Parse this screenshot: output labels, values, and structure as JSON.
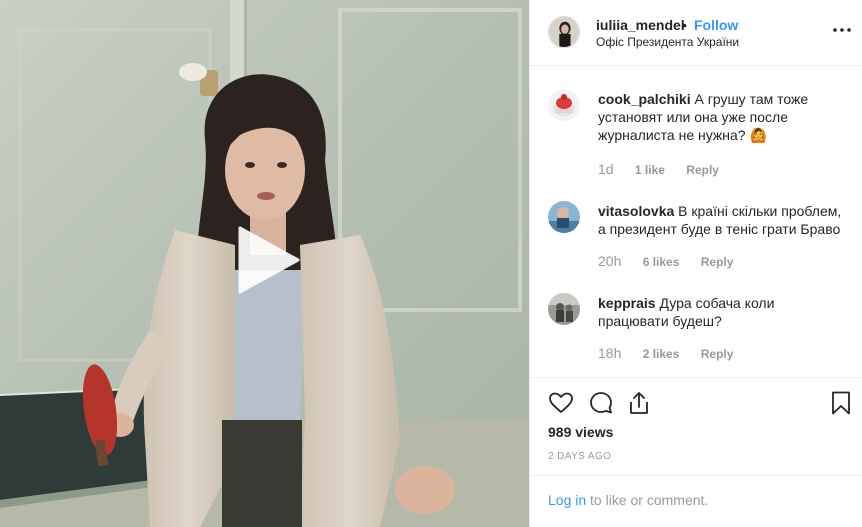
{
  "post": {
    "username": "iuliia_mendel",
    "separator": "•",
    "follow_label": "Follow",
    "location": "Офіс Президента України",
    "more_icon": "more-options-icon"
  },
  "comments": [
    {
      "username": "cook_palchiki",
      "text": "А грушу там тоже установят или она уже после журналиста не нужна? 🙆",
      "time": "1d",
      "likes": "1 like",
      "reply": "Reply"
    },
    {
      "username": "vitasolovka",
      "text": "В країні скільки проблем, а президент буде в теніс грати Браво",
      "time": "20h",
      "likes": "6 likes",
      "reply": "Reply"
    },
    {
      "username": "kepprais",
      "text": "Дура собача коли працювати будеш?",
      "time": "18h",
      "likes": "2 likes",
      "reply": "Reply"
    }
  ],
  "actions": [
    "heart-icon",
    "comment-icon",
    "share-icon",
    "bookmark-icon"
  ],
  "views": "989 views",
  "date": "2 DAYS AGO",
  "footer": {
    "login_label": "Log in",
    "login_suffix": "to like or comment."
  },
  "colors": {
    "link": "#3897f0",
    "text": "#262626",
    "muted": "#999999",
    "divider": "#efefef"
  }
}
